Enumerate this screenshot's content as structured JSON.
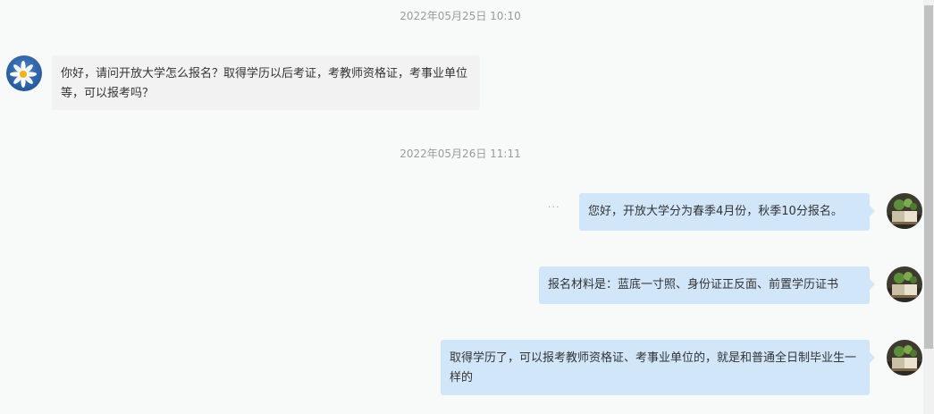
{
  "messages": [
    {
      "timestamp": "2022年05月25日 10:10",
      "sender": "other",
      "text": "你好，请问开放大学怎么报名？取得学历以后考证，考教师资格证，考事业单位等，可以报考吗？",
      "avatar_icon": "daisy-avatar-icon"
    },
    {
      "timestamp": "2022年05月26日 11:11",
      "sender": "self",
      "status": "···",
      "text": "您好，开放大学分为春季4月份，秋季10分报名。",
      "avatar_icon": "books-avatar-icon"
    },
    {
      "sender": "self",
      "text": "报名材料是：蓝底一寸照、身份证正反面、前置学历证书",
      "avatar_icon": "books-avatar-icon"
    },
    {
      "sender": "self",
      "text": "取得学历了，可以报考教师资格证、考事业单位的，就是和普通全日制毕业生一样的",
      "avatar_icon": "books-avatar-icon"
    }
  ],
  "colors": {
    "background": "#f8f9f9",
    "left_bubble": "#f2f2f2",
    "right_bubble": "#d1e6f9",
    "timestamp_text": "#9a9a9a"
  }
}
